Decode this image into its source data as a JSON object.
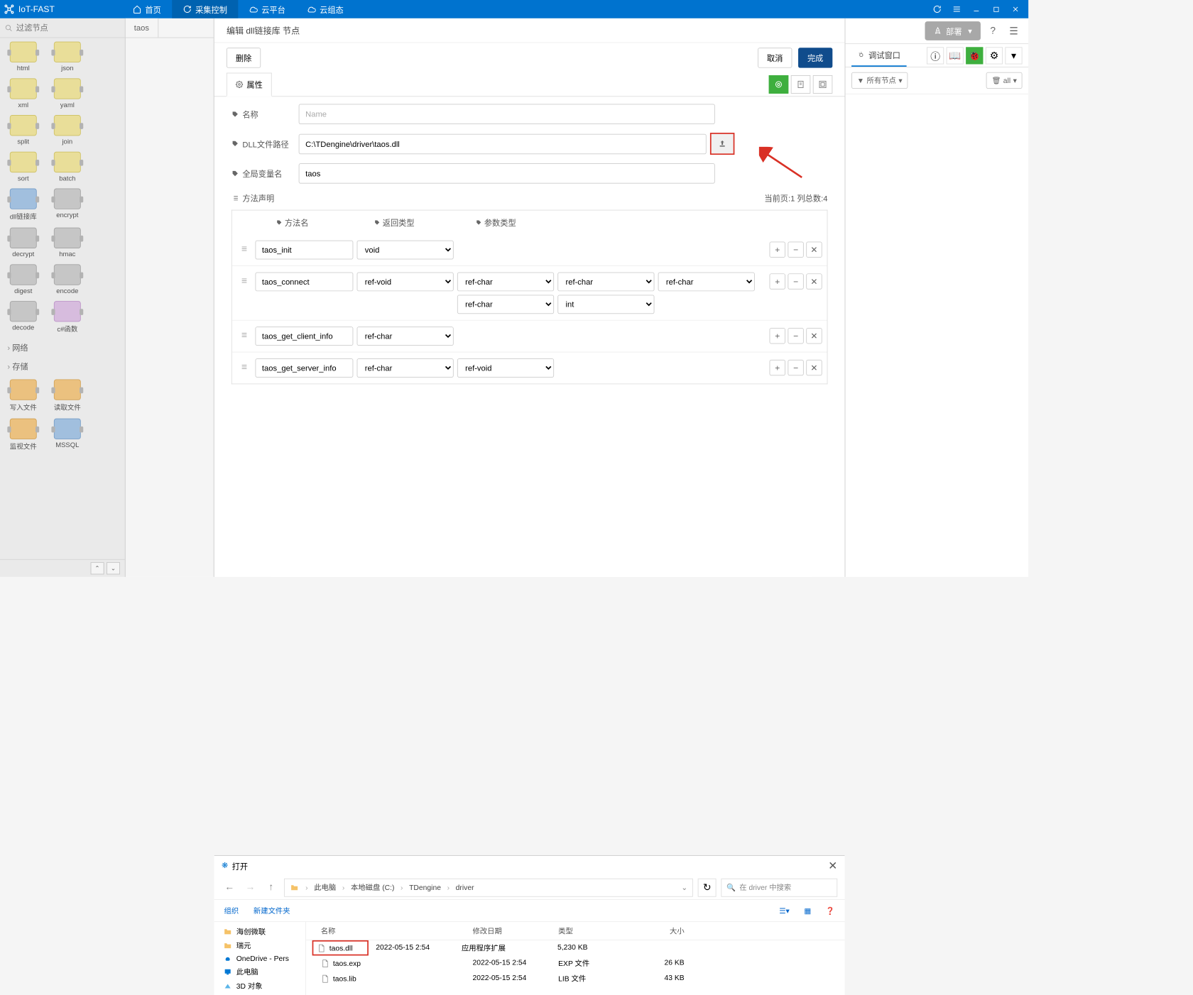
{
  "brand": "IoT-FAST",
  "topnav": [
    {
      "label": "首页",
      "icon": "home"
    },
    {
      "label": "采集控制",
      "icon": "sync",
      "active": true
    },
    {
      "label": "云平台",
      "icon": "cloud"
    },
    {
      "label": "云组态",
      "icon": "cloud-dash"
    }
  ],
  "palette": {
    "filter_placeholder": "过滤节点",
    "nodes": [
      {
        "label": "html",
        "cls": "bg-yellow"
      },
      {
        "label": "json",
        "cls": "bg-yellow"
      },
      {
        "label": "xml",
        "cls": "bg-yellow"
      },
      {
        "label": "yaml",
        "cls": "bg-yellow"
      },
      {
        "label": "split",
        "cls": "bg-yellow"
      },
      {
        "label": "join",
        "cls": "bg-yellow"
      },
      {
        "label": "sort",
        "cls": "bg-yellow"
      },
      {
        "label": "batch",
        "cls": "bg-yellow"
      },
      {
        "label": "dll链接库",
        "cls": "bg-blue"
      },
      {
        "label": "encrypt",
        "cls": "bg-gray"
      },
      {
        "label": "decrypt",
        "cls": "bg-gray"
      },
      {
        "label": "hmac",
        "cls": "bg-gray"
      },
      {
        "label": "digest",
        "cls": "bg-gray"
      },
      {
        "label": "encode",
        "cls": "bg-gray"
      },
      {
        "label": "decode",
        "cls": "bg-gray"
      },
      {
        "label": "c#函数",
        "cls": "bg-purple"
      }
    ],
    "categories": [
      "网络",
      "存储"
    ],
    "nodes2": [
      {
        "label": "写入文件",
        "cls": "bg-orange"
      },
      {
        "label": "读取文件",
        "cls": "bg-orange"
      },
      {
        "label": "监视文件",
        "cls": "bg-orange"
      },
      {
        "label": "MSSQL",
        "cls": "bg-blue"
      }
    ]
  },
  "canvas": {
    "tab": "taos"
  },
  "editor": {
    "title": "编辑 dll链接库 节点",
    "delete_btn": "删除",
    "cancel_btn": "取消",
    "done_btn": "完成",
    "properties_tab": "属性",
    "fields": {
      "name_label": "名称",
      "name_placeholder": "Name",
      "name_value": "",
      "dll_label": "DLL文件路径",
      "dll_value": "C:\\TDengine\\driver\\taos.dll",
      "global_label": "全局变量名",
      "global_value": "taos"
    },
    "methods_label": "方法声明",
    "page_info": "当前页:1   列总数:4",
    "grid_head": [
      "方法名",
      "返回类型",
      "参数类型"
    ],
    "methods": [
      {
        "name": "taos_init",
        "ret": "void",
        "params": []
      },
      {
        "name": "taos_connect",
        "ret": "ref-void",
        "params": [
          "ref-char",
          "ref-char",
          "ref-char",
          "ref-char",
          "int"
        ]
      },
      {
        "name": "taos_get_client_info",
        "ret": "ref-char",
        "params": []
      },
      {
        "name": "taos_get_server_info",
        "ret": "ref-char",
        "params": [
          "ref-void"
        ]
      }
    ]
  },
  "rightpanel": {
    "deploy": "部署",
    "debug_tab": "调试窗口",
    "filter1": "所有节点",
    "filter2": "all"
  },
  "dialog": {
    "title": "打开",
    "breadcrumb": [
      "此电脑",
      "本地磁盘 (C:)",
      "TDengine",
      "driver"
    ],
    "search_placeholder": "在 driver 中搜索",
    "organize": "组织",
    "new_folder": "新建文件夹",
    "tree": [
      "海创微联",
      "瑞元",
      "OneDrive - Pers",
      "此电脑",
      "3D 对象"
    ],
    "columns": [
      "名称",
      "修改日期",
      "类型",
      "大小"
    ],
    "files": [
      {
        "name": "taos.dll",
        "date": "2022-05-15 2:54",
        "type": "应用程序扩展",
        "size": "5,230 KB",
        "selected": true
      },
      {
        "name": "taos.exp",
        "date": "2022-05-15 2:54",
        "type": "EXP 文件",
        "size": "26 KB"
      },
      {
        "name": "taos.lib",
        "date": "2022-05-15 2:54",
        "type": "LIB 文件",
        "size": "43 KB"
      }
    ]
  }
}
